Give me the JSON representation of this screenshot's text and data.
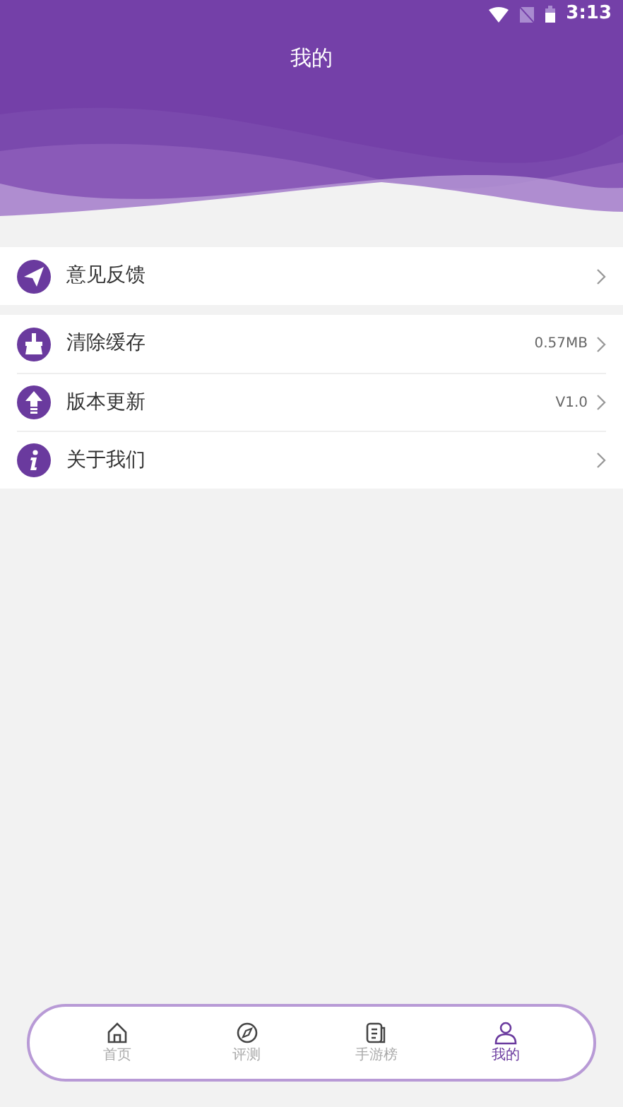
{
  "status_bar": {
    "time": "3:13"
  },
  "header": {
    "title": "我的"
  },
  "menu_groups": [
    {
      "items": [
        {
          "kind": "feedback",
          "label": "意见反馈"
        }
      ]
    },
    {
      "items": [
        {
          "kind": "cache",
          "label": "清除缓存",
          "value": "0.57MB"
        },
        {
          "kind": "update",
          "label": "版本更新",
          "value": "V1.0"
        },
        {
          "kind": "about",
          "label": "关于我们"
        }
      ]
    }
  ],
  "bottom_nav": [
    {
      "kind": "home",
      "label": "首页",
      "selected": false
    },
    {
      "kind": "review",
      "label": "评测",
      "selected": false
    },
    {
      "kind": "ranking",
      "label": "手游榜",
      "selected": false
    },
    {
      "kind": "profile",
      "label": "我的",
      "selected": true
    }
  ]
}
